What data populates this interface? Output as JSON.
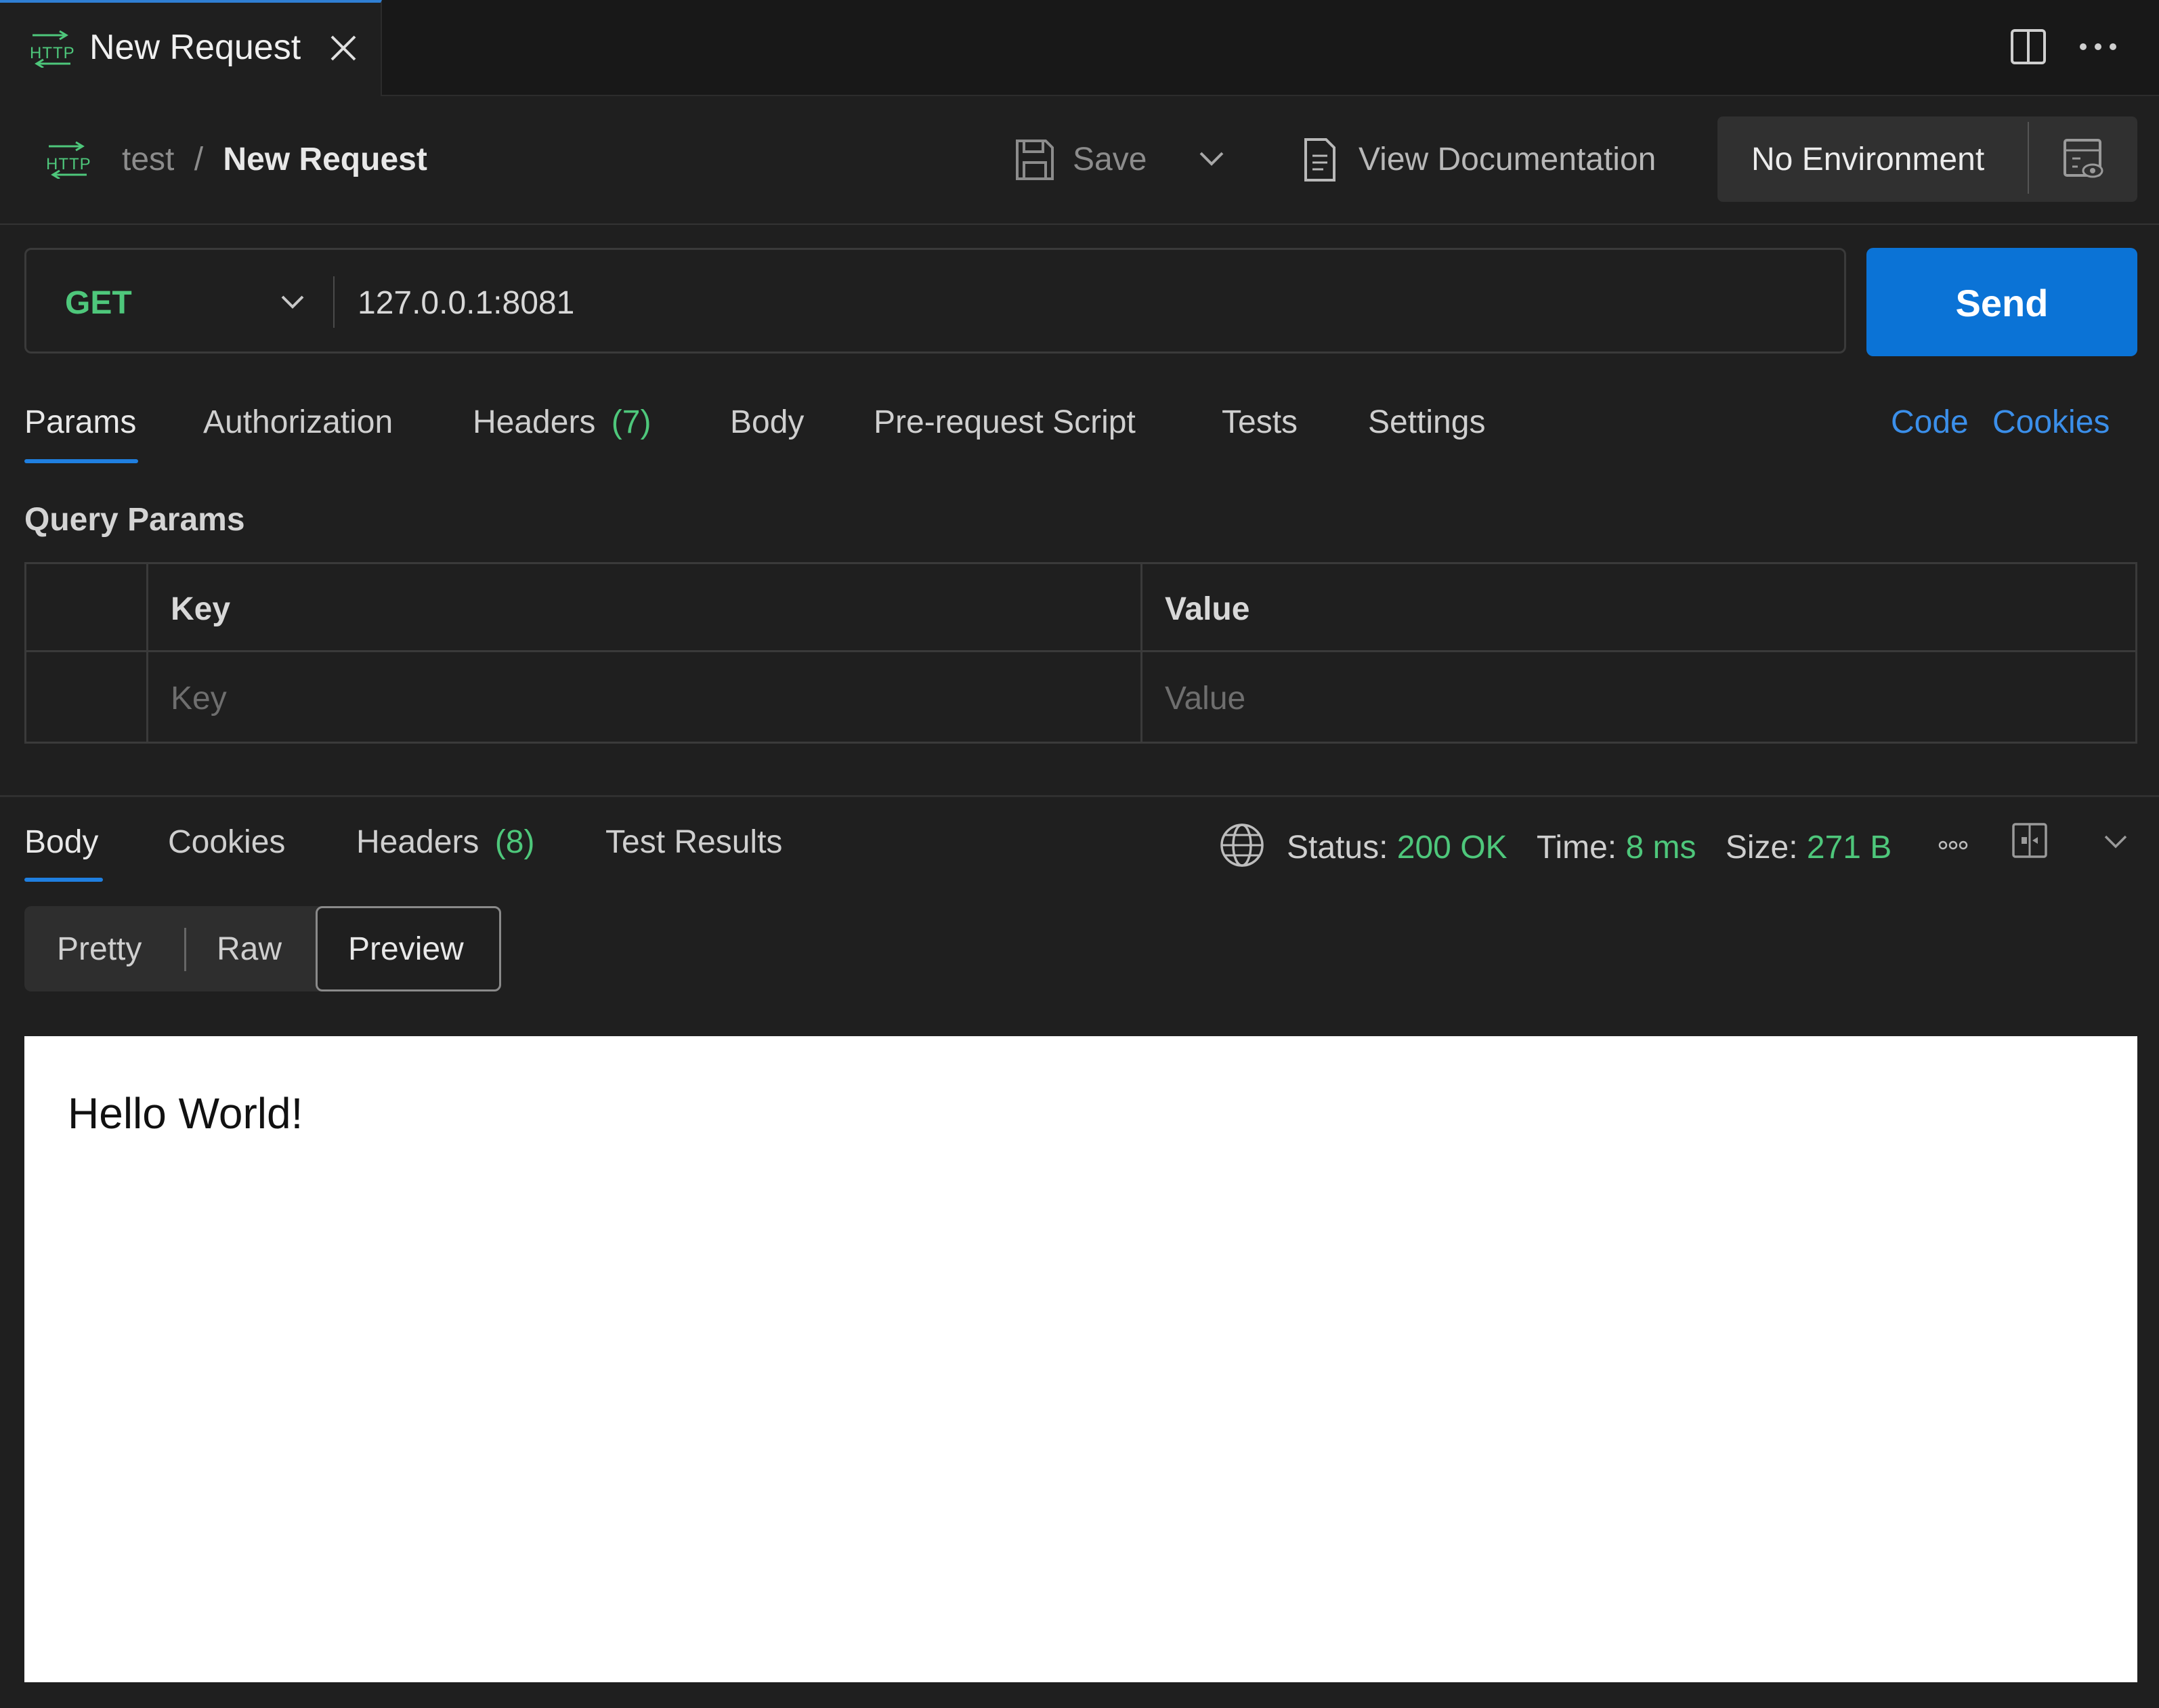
{
  "tab": {
    "title": "New Request",
    "icon": "http-icon"
  },
  "header": {
    "collection": "test",
    "separator": "/",
    "request_name": "New Request",
    "save_label": "Save",
    "view_docs_label": "View Documentation",
    "environment": "No Environment"
  },
  "request": {
    "method": "GET",
    "url": "127.0.0.1:8081",
    "send_label": "Send"
  },
  "request_tabs": {
    "params": "Params",
    "authorization": "Authorization",
    "headers": "Headers",
    "headers_count": "(7)",
    "body": "Body",
    "pre_request_script": "Pre-request Script",
    "tests": "Tests",
    "settings": "Settings",
    "code": "Code",
    "cookies": "Cookies"
  },
  "params": {
    "title": "Query Params",
    "col_key": "Key",
    "col_value": "Value",
    "key_placeholder": "Key",
    "value_placeholder": "Value"
  },
  "response_tabs": {
    "body": "Body",
    "cookies": "Cookies",
    "headers": "Headers",
    "headers_count": "(8)",
    "test_results": "Test Results"
  },
  "response_status": {
    "status_label": "Status:",
    "status_value": "200 OK",
    "time_label": "Time:",
    "time_value": "8 ms",
    "size_label": "Size:",
    "size_value": "271 B"
  },
  "view_modes": {
    "pretty": "Pretty",
    "raw": "Raw",
    "preview": "Preview"
  },
  "preview_content": "Hello World!",
  "colors": {
    "accent_blue": "#0b73d6",
    "method_green": "#4ec77b",
    "link_blue": "#3b8fea",
    "background": "#1f1f1f"
  }
}
